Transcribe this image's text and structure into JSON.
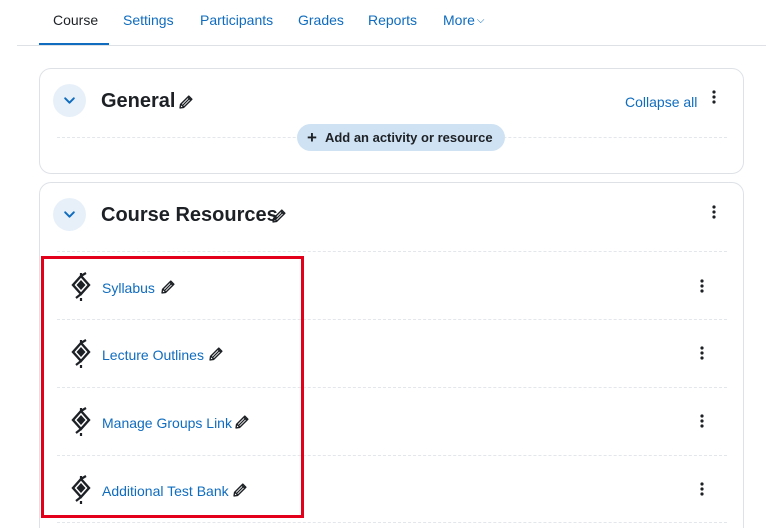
{
  "nav": {
    "tabs": [
      {
        "label": "Course",
        "active": true
      },
      {
        "label": "Settings"
      },
      {
        "label": "Participants"
      },
      {
        "label": "Grades"
      },
      {
        "label": "Reports"
      },
      {
        "label": "More"
      }
    ],
    "more_icon": "chevron-down-icon"
  },
  "sections": {
    "general": {
      "title": "General",
      "collapse_all": "Collapse all",
      "add_activity": "Add an activity or resource"
    },
    "resources": {
      "title": "Course Resources",
      "activities": [
        {
          "label": "Syllabus",
          "icon": "url-resource-icon"
        },
        {
          "label": "Lecture Outlines",
          "icon": "url-resource-icon"
        },
        {
          "label": "Manage Groups Link",
          "icon": "url-resource-icon"
        },
        {
          "label": "Additional Test Bank",
          "icon": "url-resource-icon"
        }
      ]
    }
  },
  "colors": {
    "link": "#0f6cbf",
    "text": "#1d2125",
    "chevron_bg": "#e7f0f9",
    "add_button_bg": "#cfe2f3",
    "highlight": "#e2001a",
    "border": "#dee2e6"
  }
}
